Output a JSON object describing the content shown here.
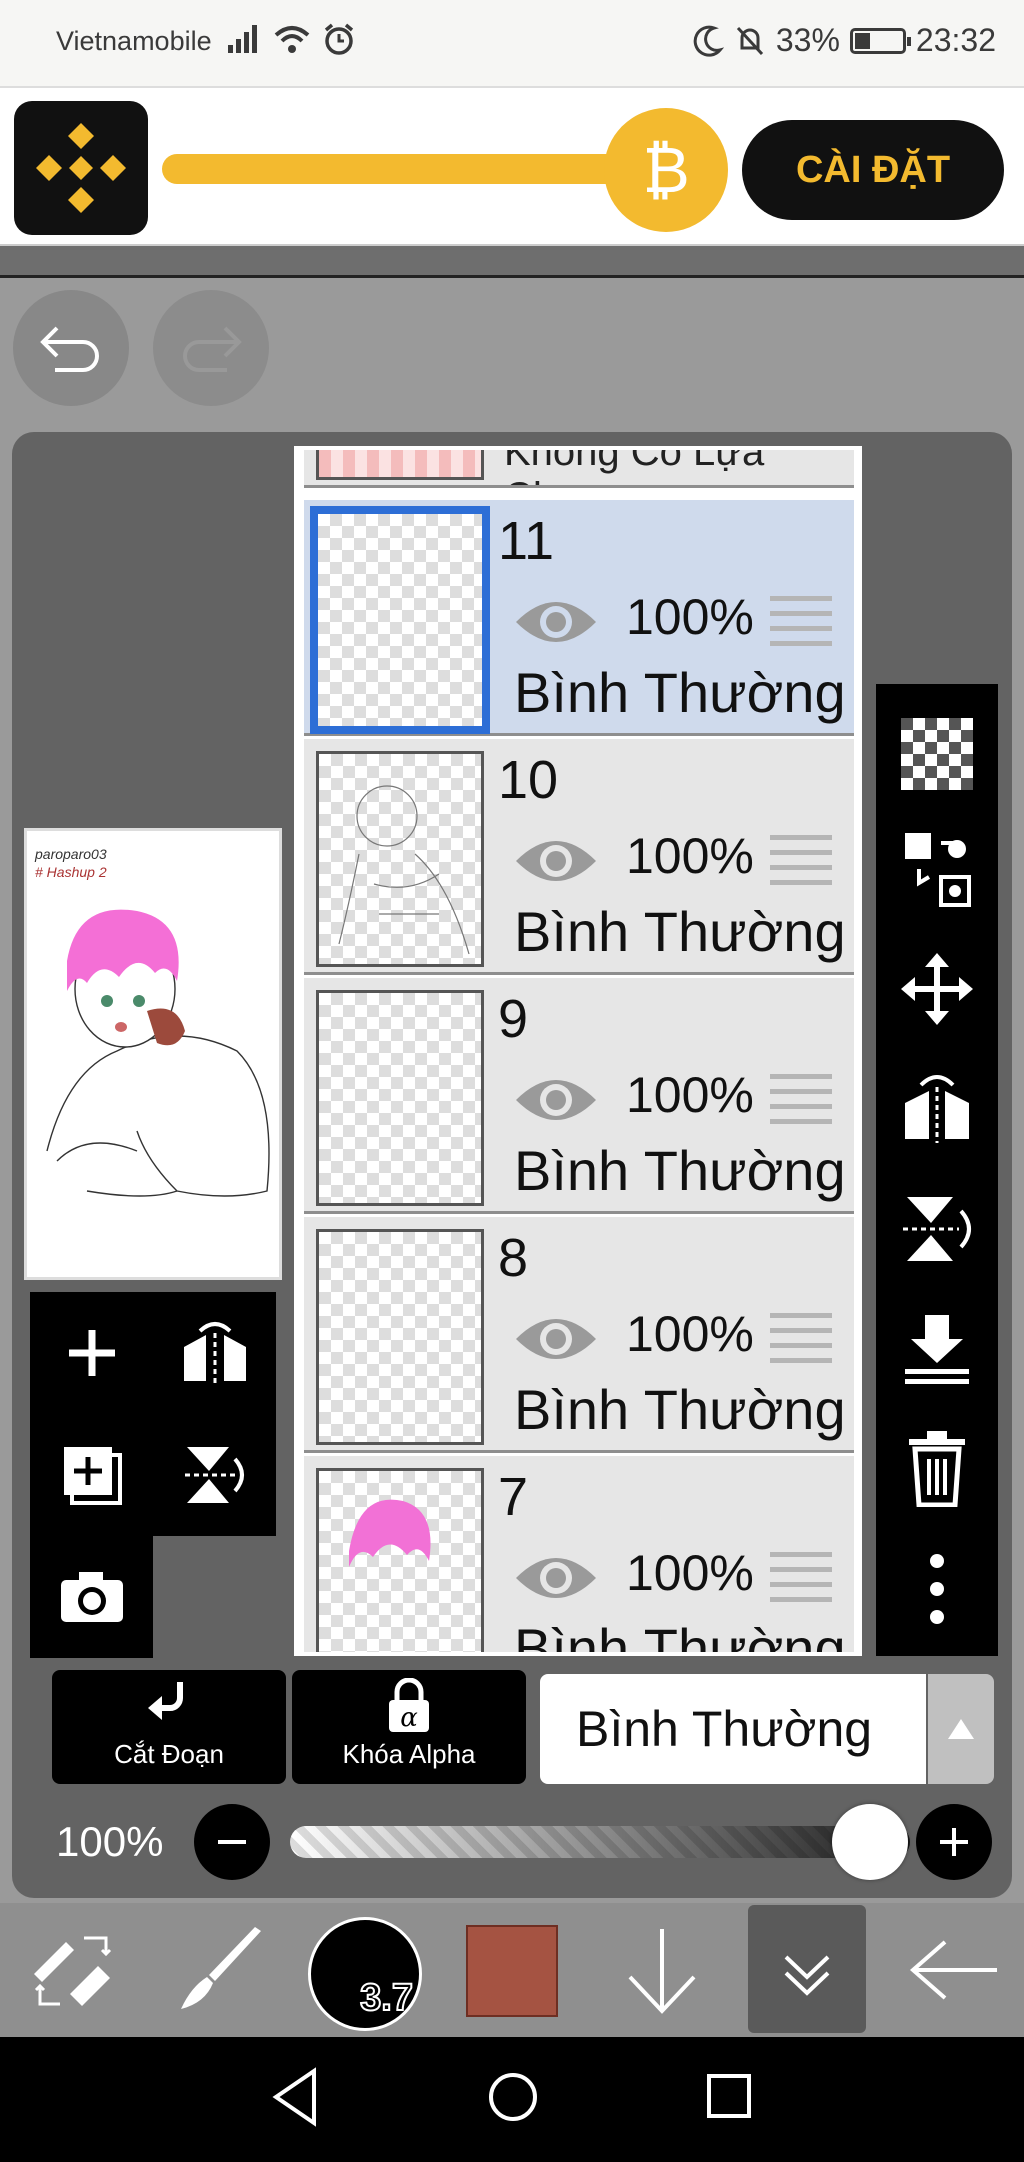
{
  "status_bar": {
    "carrier": "Vietnamobile",
    "battery_percent": "33%",
    "battery_level": 0.33,
    "time": "23:32"
  },
  "ad": {
    "install_label": "CÀI ĐẶT",
    "coin_symbol": "₿",
    "brand_color": "#f3ba2f"
  },
  "layers": {
    "top_partial_label": "Không Có Lựa Chọn",
    "rows": [
      {
        "number": "11",
        "opacity": "100%",
        "blend": "Bình Thường",
        "selected": true
      },
      {
        "number": "10",
        "opacity": "100%",
        "blend": "Bình Thường",
        "selected": false
      },
      {
        "number": "9",
        "opacity": "100%",
        "blend": "Bình Thường",
        "selected": false
      },
      {
        "number": "8",
        "opacity": "100%",
        "blend": "Bình Thường",
        "selected": false
      },
      {
        "number": "7",
        "opacity": "100%",
        "blend": "Bình Thường",
        "selected": false
      }
    ]
  },
  "preview": {
    "signature_line1": "paroparo03",
    "signature_line2": "# Hashup 2"
  },
  "controls": {
    "clip_label": "Cắt Đoạn",
    "alpha_lock_label": "Khóa Alpha",
    "blend_mode": "Bình Thường",
    "opacity_label": "100%",
    "opacity_value": 1.0
  },
  "brush": {
    "size": "3.7",
    "color": "#a55342"
  },
  "icons": {
    "right_toolbar": [
      "transparency-grid-icon",
      "copy-layer-icon",
      "move-icon",
      "flip-horizontal-icon",
      "flip-vertical-icon",
      "merge-down-icon",
      "trash-icon",
      "more-icon"
    ],
    "left_tools": [
      "add-layer-icon",
      "flip-layer-h-icon",
      "add-copy-layer-icon",
      "flip-layer-v-icon",
      "camera-icon"
    ],
    "bottom_toolbar": [
      "tool-switch-icon",
      "brush-icon",
      "brush-size",
      "color-swatch",
      "arrow-down-icon",
      "double-chevron-down-icon",
      "back-arrow-icon"
    ]
  }
}
